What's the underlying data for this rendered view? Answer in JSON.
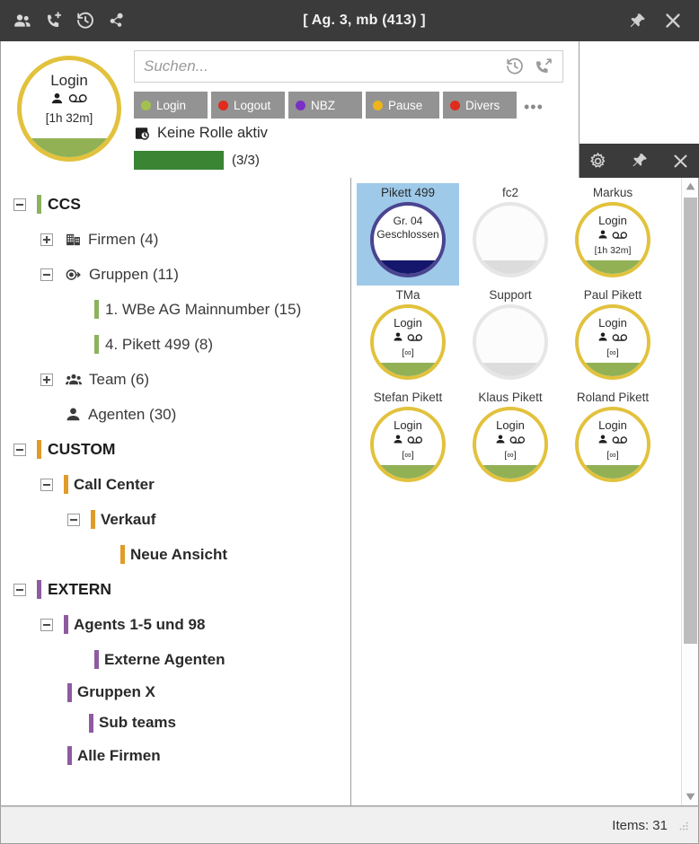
{
  "titlebar": {
    "title": "[ Ag. 3, mb (413) ]",
    "left_icons": [
      {
        "name": "contacts-icon",
        "label": "Contacts"
      },
      {
        "name": "phone-add-icon",
        "label": "New call"
      },
      {
        "name": "call-history-icon",
        "label": "History"
      },
      {
        "name": "presence-nodes-icon",
        "label": "Presence"
      }
    ],
    "pin_label": "Pin",
    "close_label": "Close"
  },
  "agent": {
    "avatar": {
      "status": "Login",
      "duration": "[1h 32m]",
      "ring_color": "#e2c23d",
      "fill_color": "#92b155",
      "person_icon": "person-icon",
      "voicemail_icon": "voicemail-icon"
    },
    "search": {
      "placeholder": "Suchen...",
      "value": "",
      "history_icon": "history-icon",
      "outgoing_call_icon": "outgoing-call-icon"
    },
    "status_buttons": [
      {
        "label": "Login",
        "color": "#a3c14e"
      },
      {
        "label": "Logout",
        "color": "#e02b1d"
      },
      {
        "label": "NBZ",
        "color": "#7b30c4"
      },
      {
        "label": "Pause",
        "color": "#edb41d"
      },
      {
        "label": "Divers",
        "color": "#e02b1d"
      }
    ],
    "more_label": "•••",
    "role": {
      "icon": "calendar-clock-icon",
      "text": "Keine Rolle aktiv"
    },
    "progress": {
      "label": "(3/3)",
      "percent": 100,
      "fill_color": "#3a8434"
    }
  },
  "minibar": {
    "settings_label": "Einstellungen",
    "pin_label": "Pin",
    "close_label": "Close"
  },
  "tree": [
    {
      "label": "CCS",
      "indent": 0,
      "toggle": "minus",
      "bar": "#8cb25e",
      "style": "hdr",
      "icon": null
    },
    {
      "label": "Firmen (4)",
      "indent": 1,
      "toggle": "plus",
      "bar": null,
      "style": "plain",
      "icon": "building-icon"
    },
    {
      "label": "Gruppen (11)",
      "indent": 1,
      "toggle": "minus",
      "bar": null,
      "style": "plain",
      "icon": "group-link-icon"
    },
    {
      "label": "1. WBe AG Mainnumber (15)",
      "indent": 3,
      "toggle": "none",
      "bar": "#8cb25e",
      "style": "plain",
      "icon": null
    },
    {
      "label": "4. Pikett 499 (8)",
      "indent": 3,
      "toggle": "none",
      "bar": "#8cb25e",
      "style": "plain",
      "icon": null
    },
    {
      "label": "Team (6)",
      "indent": 1,
      "toggle": "plus",
      "bar": null,
      "style": "plain",
      "icon": "team-icon"
    },
    {
      "label": "Agenten (30)",
      "indent": 1,
      "toggle": "none",
      "bar": null,
      "style": "plain",
      "icon": "person-icon"
    },
    {
      "label": "CUSTOM",
      "indent": 0,
      "toggle": "minus",
      "bar": "#e09b28",
      "style": "hdr",
      "icon": null
    },
    {
      "label": "Call Center",
      "indent": 1,
      "toggle": "minus",
      "bar": "#e09b28",
      "style": "semi",
      "icon": null
    },
    {
      "label": "Verkauf",
      "indent": 2,
      "toggle": "minus",
      "bar": "#e09b28",
      "style": "semi",
      "icon": null
    },
    {
      "label": "Neue Ansicht",
      "indent": 3,
      "toggle": "none",
      "bar": "#e09b28",
      "style": "semi",
      "icon": null
    },
    {
      "label": "EXTERN",
      "indent": 0,
      "toggle": "minus",
      "bar": "#8e5ba0",
      "style": "hdr",
      "icon": null
    },
    {
      "label": "Agents 1-5 und 98",
      "indent": 1,
      "toggle": "minus",
      "bar": "#8e5ba0",
      "style": "semi",
      "icon": null
    },
    {
      "label": "Externe Agenten",
      "indent": 2,
      "toggle": "none",
      "bar": "#8e5ba0",
      "style": "semi",
      "icon": null
    },
    {
      "label": "Gruppen X",
      "indent": 1,
      "toggle": "none",
      "bar": "#8e5ba0",
      "style": "semi",
      "icon": null
    },
    {
      "label": "Sub teams",
      "indent": 2,
      "toggle": "none",
      "bar": "#8e5ba0",
      "style": "semi",
      "icon": null
    },
    {
      "label": "Alle Firmen",
      "indent": 1,
      "toggle": "none",
      "bar": "#8e5ba0",
      "style": "semi",
      "icon": null
    }
  ],
  "tiles": [
    {
      "name": "Pikett 499",
      "kind": "closed",
      "selected": true,
      "line1": "Gr. 04",
      "line2": "Geschlossen",
      "ring": "#4a4490",
      "fill": "#14176b"
    },
    {
      "name": "fc2",
      "kind": "empty",
      "selected": false,
      "ring": "#e6e6e6",
      "fill": "#dcdcdc"
    },
    {
      "name": "Markus",
      "kind": "login",
      "selected": false,
      "status": "Login",
      "duration": "[1h 32m]",
      "ring": "#e2c23d",
      "fill": "#92b155"
    },
    {
      "name": "TMa",
      "kind": "login",
      "selected": false,
      "status": "Login",
      "duration": "[∞]",
      "ring": "#e2c23d",
      "fill": "#92b155"
    },
    {
      "name": "Support",
      "kind": "empty",
      "selected": false,
      "ring": "#e6e6e6",
      "fill": "#dcdcdc"
    },
    {
      "name": "Paul Pikett",
      "kind": "login",
      "selected": false,
      "status": "Login",
      "duration": "[∞]",
      "ring": "#e2c23d",
      "fill": "#92b155"
    },
    {
      "name": "Stefan Pikett",
      "kind": "login",
      "selected": false,
      "status": "Login",
      "duration": "[∞]",
      "ring": "#e2c23d",
      "fill": "#92b155"
    },
    {
      "name": "Klaus Pikett",
      "kind": "login",
      "selected": false,
      "status": "Login",
      "duration": "[∞]",
      "ring": "#e2c23d",
      "fill": "#92b155"
    },
    {
      "name": "Roland Pikett",
      "kind": "login",
      "selected": false,
      "status": "Login",
      "duration": "[∞]",
      "ring": "#e2c23d",
      "fill": "#92b155"
    }
  ],
  "scrollbar": {
    "up_label": "Scroll up",
    "down_label": "Scroll down"
  },
  "statusbar": {
    "items_text": "Items: 31"
  }
}
